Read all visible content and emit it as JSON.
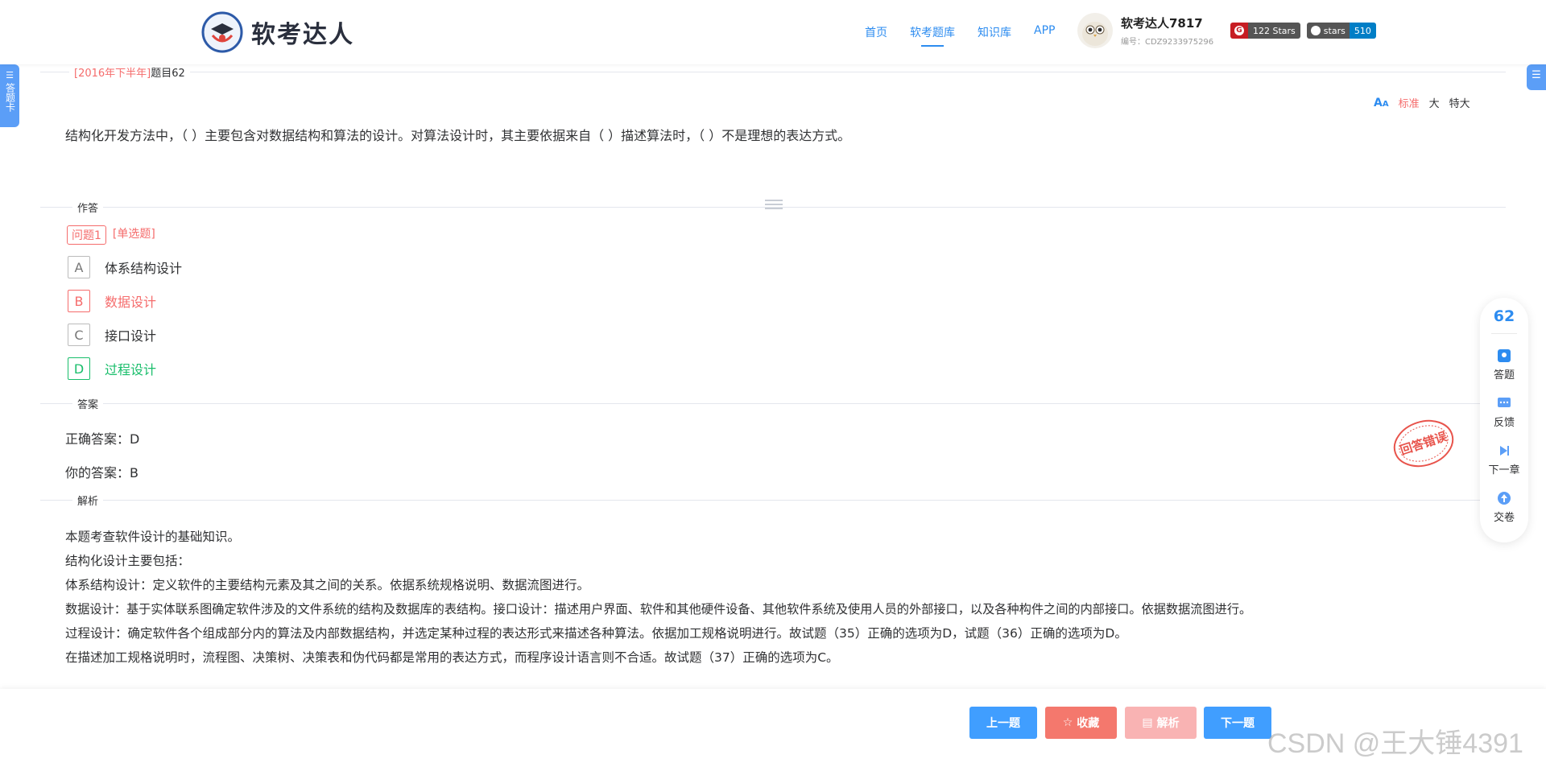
{
  "header": {
    "logo_text": "软考达人",
    "nav": [
      "首页",
      "软考题库",
      "知识库",
      "APP"
    ],
    "nav_active": 1,
    "user_name": "软考达人7817",
    "user_id": "编号：CDZ9233975296",
    "badges": [
      {
        "icon": "gitee-icon",
        "left": "",
        "right": "122 Stars"
      },
      {
        "icon": "github-icon",
        "left": "stars",
        "right": "510"
      }
    ]
  },
  "side_left_label": "答题卡",
  "crumb": {
    "year": "[2016年下半年]",
    "title": "题目62"
  },
  "font_size": {
    "options": [
      "标准",
      "大",
      "特大"
    ],
    "active": 0
  },
  "question_text": "结构化开发方法中，（ ）主要包含对数据结构和算法的设计。对算法设计时，其主要依据来自（ ）描述算法时，（ ）不是理想的表达方式。",
  "sections": {
    "answer_area": "作答",
    "answer": "答案",
    "analysis": "解析"
  },
  "question_tag": {
    "number": "问题1",
    "type": "[单选题]"
  },
  "options": [
    {
      "letter": "A",
      "text": "体系结构设计",
      "state": "normal"
    },
    {
      "letter": "B",
      "text": "数据设计",
      "state": "wrong"
    },
    {
      "letter": "C",
      "text": "接口设计",
      "state": "normal"
    },
    {
      "letter": "D",
      "text": "过程设计",
      "state": "right"
    }
  ],
  "answer": {
    "correct": "正确答案：D",
    "yours": "你的答案：B"
  },
  "stamp_text": "回答错误",
  "analysis_lines": [
    "本题考查软件设计的基础知识。",
    "结构化设计主要包括：",
    "体系结构设计：定义软件的主要结构元素及其之间的关系。依据系统规格说明、数据流图进行。",
    "数据设计：基于实体联系图确定软件涉及的文件系统的结构及数据库的表结构。接口设计：描述用户界面、软件和其他硬件设备、其他软件系统及使用人员的外部接口，以及各种构件之间的内部接口。依据数据流图进行。",
    "过程设计：确定软件各个组成部分内的算法及内部数据结构，并选定某种过程的表达形式来描述各种算法。依据加工规格说明进行。故试题（35）正确的选项为D，试题（36）正确的选项为D。",
    "在描述加工规格说明时，流程图、决策树、决策表和伪代码都是常用的表达方式，而程序设计语言则不合适。故试题（37）正确的选项为C。"
  ],
  "float_panel": {
    "number": "62",
    "items": [
      "答题",
      "反馈",
      "下一章",
      "交卷"
    ]
  },
  "footer": {
    "prev": "上一题",
    "fav": "收藏",
    "analysis": "解析",
    "next": "下一题"
  },
  "watermark": "CSDN @王大锤4391",
  "colors": {
    "primary": "#409eff",
    "wrong": "#f56c6c",
    "right": "#19be6b"
  }
}
